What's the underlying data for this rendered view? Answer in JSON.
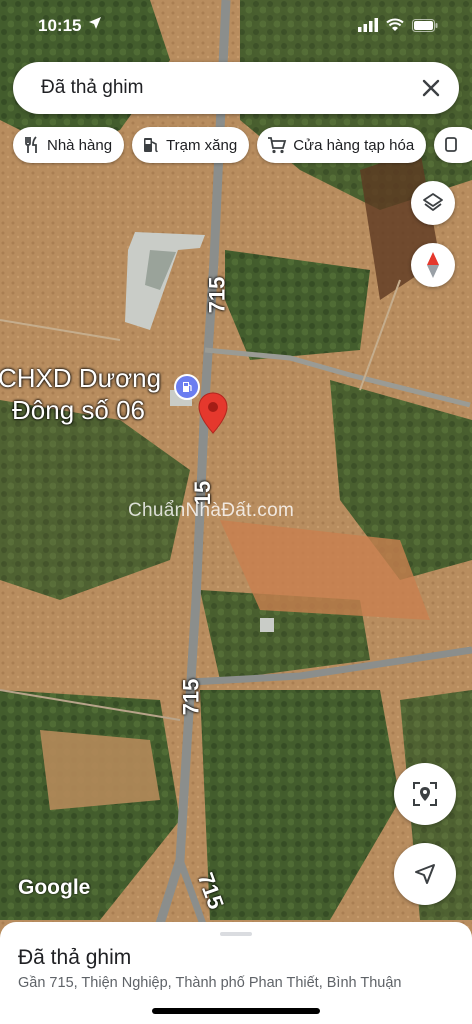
{
  "status_bar": {
    "time": "10:15",
    "location_icon": "location-arrow-icon",
    "signal_icon": "cell-signal-icon",
    "wifi_icon": "wifi-icon",
    "battery_icon": "battery-icon"
  },
  "search": {
    "value": "Đã thả ghim",
    "close_icon": "close-icon"
  },
  "chips": [
    {
      "label": "Nhà hàng",
      "icon": "restaurant-icon"
    },
    {
      "label": "Trạm xăng",
      "icon": "gas-station-icon"
    },
    {
      "label": "Cửa hàng tạp hóa",
      "icon": "cart-icon"
    }
  ],
  "map": {
    "poi": {
      "line1": "CHXD Dương",
      "line2": "Đông số 06",
      "icon": "gas-pump-icon"
    },
    "road_labels": [
      "715",
      "15",
      "715",
      "715"
    ],
    "watermark": "ChuẩnNhàĐất.com",
    "attribution": "Google",
    "colors": {
      "terrain": "#b48a5c",
      "vegetation": "#3f5d2c",
      "road": "#8b8e8c",
      "pin": "#e5382d",
      "poi_pin": "#6b7ef0"
    }
  },
  "controls": {
    "layers_icon": "layers-icon",
    "compass_icon": "compass-icon",
    "scan_icon": "location-scan-icon",
    "navigate_icon": "navigate-arrow-icon"
  },
  "sheet": {
    "title": "Đã thả ghim",
    "address": "Gần 715, Thiện Nghiệp, Thành phố Phan Thiết, Bình Thuận"
  }
}
